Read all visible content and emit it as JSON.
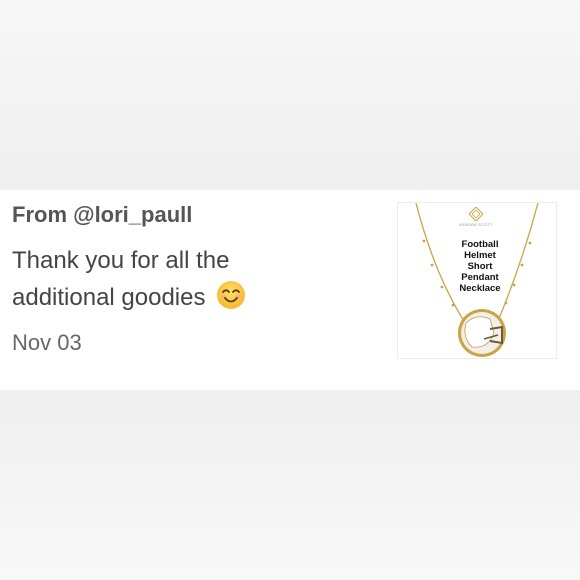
{
  "review": {
    "from": "From @lori_paull",
    "message": "Thank you for all the additional goodies",
    "emoji": "smiling-face-emoji",
    "date": "Nov 03"
  },
  "product_image": {
    "brand": "KENDRA SCOTT",
    "title_lines": [
      "Football",
      "Helmet",
      "Short",
      "Pendant",
      "Necklace"
    ]
  },
  "colors": {
    "gold": "#c9a447",
    "text": "#444444",
    "emoji_yellow": "#ffc83d"
  }
}
